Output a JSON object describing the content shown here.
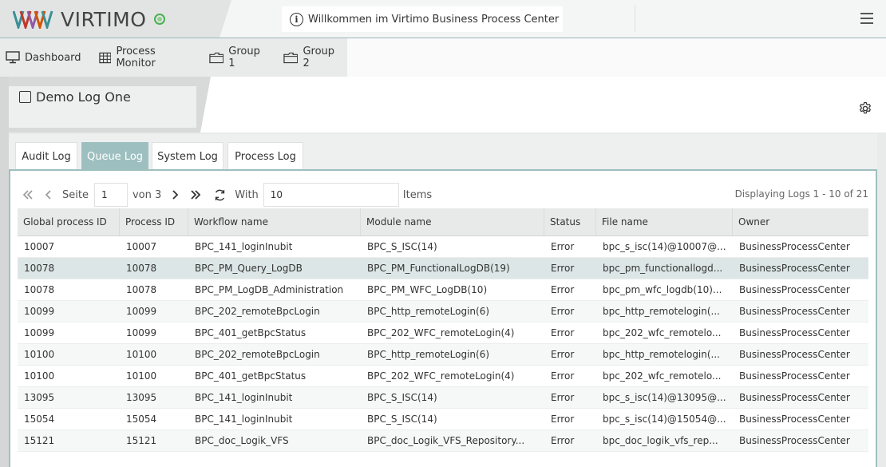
{
  "app": {
    "brand": "VIRTIMO",
    "logo_colors": [
      "#3a8f96",
      "#c0392b",
      "#8e5aa6",
      "#d35400",
      "#3a8f96",
      "#555555"
    ],
    "welcome_text": "Willkommen im Virtimo Business Process Center",
    "status_color": "#4caf50"
  },
  "nav": {
    "items": [
      {
        "label": "Dashboard",
        "icon": "monitor-icon"
      },
      {
        "label": "Process Monitor",
        "icon": "table-icon"
      },
      {
        "label": "Group 1",
        "icon": "folder-icon"
      },
      {
        "label": "Group 2",
        "icon": "folder-icon"
      }
    ]
  },
  "page": {
    "title": "Demo Log One"
  },
  "tabs": [
    {
      "label": "Audit Log",
      "active": false
    },
    {
      "label": "Queue Log",
      "active": true
    },
    {
      "label": "System Log",
      "active": false
    },
    {
      "label": "Process Log",
      "active": false
    }
  ],
  "pager": {
    "page_label": "Seite",
    "page_value": "1",
    "of_label": "von 3",
    "with_label": "With",
    "items_value": "10",
    "items_label": "Items",
    "displaying": "Displaying Logs 1 - 10 of 21"
  },
  "table": {
    "columns": [
      "Global process ID",
      "Process ID",
      "Workflow name",
      "Module name",
      "Status",
      "File name",
      "Owner"
    ],
    "rows": [
      [
        "10007",
        "10007",
        "BPC_141_loginInubit",
        "BPC_S_ISC(14)",
        "Error",
        "bpc_s_isc(14)@10007@...",
        "BusinessProcessCenter"
      ],
      [
        "10078",
        "10078",
        "BPC_PM_Query_LogDB",
        "BPC_PM_FunctionalLogDB(19)",
        "Error",
        "bpc_pm_functionallogd...",
        "BusinessProcessCenter"
      ],
      [
        "10078",
        "10078",
        "BPC_PM_LogDB_Administration",
        "BPC_PM_WFC_LogDB(10)",
        "Error",
        "bpc_pm_wfc_logdb(10)...",
        "BusinessProcessCenter"
      ],
      [
        "10099",
        "10099",
        "BPC_202_remoteBpcLogin",
        "BPC_http_remoteLogin(6)",
        "Error",
        "bpc_http_remotelogin(...",
        "BusinessProcessCenter"
      ],
      [
        "10099",
        "10099",
        "BPC_401_getBpcStatus",
        "BPC_202_WFC_remoteLogin(4)",
        "Error",
        "bpc_202_wfc_remotelo...",
        "BusinessProcessCenter"
      ],
      [
        "10100",
        "10100",
        "BPC_202_remoteBpcLogin",
        "BPC_http_remoteLogin(6)",
        "Error",
        "bpc_http_remotelogin(...",
        "BusinessProcessCenter"
      ],
      [
        "10100",
        "10100",
        "BPC_401_getBpcStatus",
        "BPC_202_WFC_remoteLogin(4)",
        "Error",
        "bpc_202_wfc_remotelo...",
        "BusinessProcessCenter"
      ],
      [
        "13095",
        "13095",
        "BPC_141_loginInubit",
        "BPC_S_ISC(14)",
        "Error",
        "bpc_s_isc(14)@13095@...",
        "BusinessProcessCenter"
      ],
      [
        "15054",
        "15054",
        "BPC_141_loginInubit",
        "BPC_S_ISC(14)",
        "Error",
        "bpc_s_isc(14)@15054@...",
        "BusinessProcessCenter"
      ],
      [
        "15121",
        "15121",
        "BPC_doc_Logik_VFS",
        "BPC_doc_Logik_VFS_Repository...",
        "Error",
        "bpc_doc_logik_vfs_rep...",
        "BusinessProcessCenter"
      ]
    ],
    "selected_row": 1
  }
}
